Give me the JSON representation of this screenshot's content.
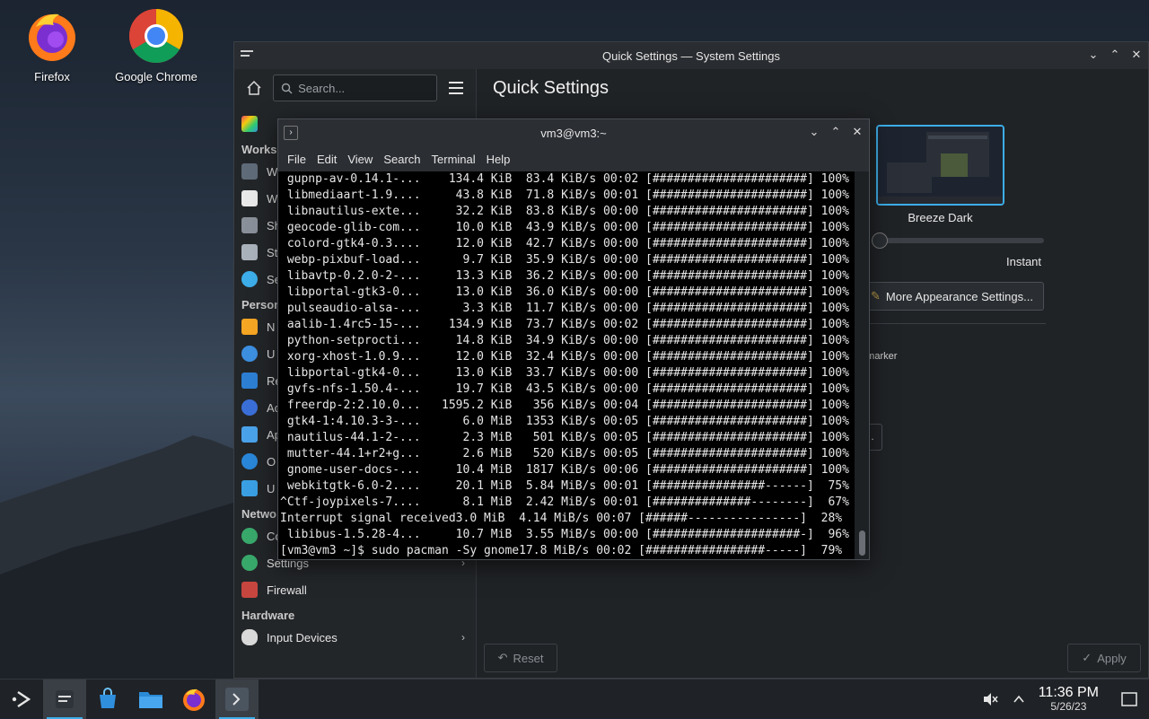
{
  "desktop": {
    "icons": [
      {
        "label": "Firefox"
      },
      {
        "label": "Google Chrome"
      }
    ]
  },
  "settings_window": {
    "title": "Quick Settings — System Settings",
    "search_placeholder": "Search...",
    "page_title": "Quick Settings",
    "sidebar": {
      "sections": {
        "workspace": "Works",
        "personal": "Person",
        "network": "Netwo",
        "hardware": "Hardware"
      },
      "items": [
        {
          "label": "W"
        },
        {
          "label": "W"
        },
        {
          "label": "Sh"
        },
        {
          "label": "St"
        },
        {
          "label": "Se"
        },
        {
          "label": "N"
        },
        {
          "label": "U"
        },
        {
          "label": "Re"
        },
        {
          "label": "Ac"
        },
        {
          "label": "Ap"
        },
        {
          "label": "O"
        },
        {
          "label": "U"
        },
        {
          "label": "Connections"
        },
        {
          "label": "Settings"
        },
        {
          "label": "Firewall"
        },
        {
          "label": "Input Devices"
        }
      ]
    },
    "theme": {
      "label": "Breeze Dark"
    },
    "animation_label": "Instant",
    "more_appearance_button": "More Appearance Settings...",
    "marker_label": "n marker",
    "small_box_label": ".",
    "reset_button": "Reset",
    "apply_button": "Apply"
  },
  "terminal": {
    "title": "vm3@vm3:~",
    "menu": [
      "File",
      "Edit",
      "View",
      "Search",
      "Terminal",
      "Help"
    ],
    "lines": [
      " gupnp-av-0.14.1-...    134.4 KiB  83.4 KiB/s 00:02 [######################] 100%",
      " libmediaart-1.9....     43.8 KiB  71.8 KiB/s 00:01 [######################] 100%",
      " libnautilus-exte...     32.2 KiB  83.8 KiB/s 00:00 [######################] 100%",
      " geocode-glib-com...     10.0 KiB  43.9 KiB/s 00:00 [######################] 100%",
      " colord-gtk4-0.3....     12.0 KiB  42.7 KiB/s 00:00 [######################] 100%",
      " webp-pixbuf-load...      9.7 KiB  35.9 KiB/s 00:00 [######################] 100%",
      " libavtp-0.2.0-2-...     13.3 KiB  36.2 KiB/s 00:00 [######################] 100%",
      " libportal-gtk3-0...     13.0 KiB  36.0 KiB/s 00:00 [######################] 100%",
      " pulseaudio-alsa-...      3.3 KiB  11.7 KiB/s 00:00 [######################] 100%",
      " aalib-1.4rc5-15-...    134.9 KiB  73.7 KiB/s 00:02 [######################] 100%",
      " python-setprocti...     14.8 KiB  34.9 KiB/s 00:00 [######################] 100%",
      " xorg-xhost-1.0.9...     12.0 KiB  32.4 KiB/s 00:00 [######################] 100%",
      " libportal-gtk4-0...     13.0 KiB  33.7 KiB/s 00:00 [######################] 100%",
      " gvfs-nfs-1.50.4-...     19.7 KiB  43.5 KiB/s 00:00 [######################] 100%",
      " freerdp-2:2.10.0...   1595.2 KiB   356 KiB/s 00:04 [######################] 100%",
      " gtk4-1:4.10.3-3-...      6.0 MiB  1353 KiB/s 00:05 [######################] 100%",
      " nautilus-44.1-2-...      2.3 MiB   501 KiB/s 00:05 [######################] 100%",
      " mutter-44.1+r2+g...      2.6 MiB   520 KiB/s 00:05 [######################] 100%",
      " gnome-user-docs-...     10.4 MiB  1817 KiB/s 00:06 [######################] 100%",
      " webkitgtk-6.0-2....     20.1 MiB  5.84 MiB/s 00:01 [################------]  75%",
      "^Ctf-joypixels-7....      8.1 MiB  2.42 MiB/s 00:01 [##############--------]  67%",
      "Interrupt signal received3.0 MiB  4.14 MiB/s 00:07 [######----------------]  28%",
      " libibus-1.5.28-4...     10.7 MiB  3.55 MiB/s 00:00 [#####################-]  96%",
      "[vm3@vm3 ~]$ sudo pacman -Sy gnome17.8 MiB/s 00:02 [#################-----]  79%"
    ]
  },
  "taskbar": {
    "time": "11:36 PM",
    "date": "5/26/23"
  },
  "colors": {
    "accent": "#3daee9",
    "panel": "#1f2226",
    "window_bg": "#202326"
  }
}
